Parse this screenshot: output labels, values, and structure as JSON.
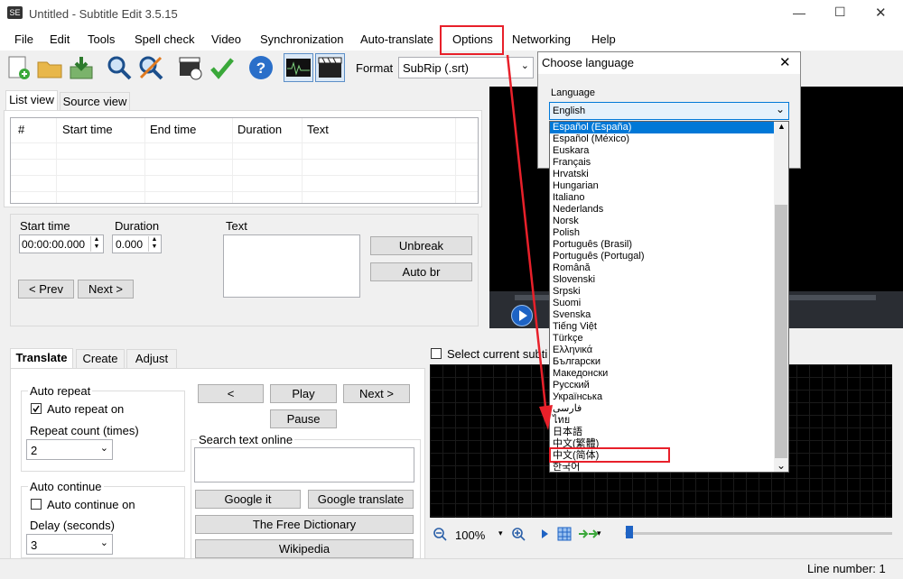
{
  "window": {
    "title": "Untitled - Subtitle Edit 3.5.15",
    "app_icon_text": "SE",
    "minimize": "—",
    "maximize": "☐",
    "close": "✕"
  },
  "menu": [
    "File",
    "Edit",
    "Tools",
    "Spell check",
    "Video",
    "Synchronization",
    "Auto-translate",
    "Options",
    "Networking",
    "Help"
  ],
  "toolbar": {
    "format_label": "Format",
    "format_value": "SubRip (.srt)"
  },
  "list": {
    "tabs": [
      "List view",
      "Source view"
    ],
    "columns": [
      "#",
      "Start time",
      "End time",
      "Duration",
      "Text"
    ]
  },
  "editor": {
    "start_time_label": "Start time",
    "start_time_value": "00:00:00.000",
    "duration_label": "Duration",
    "duration_value": "0.000",
    "text_label": "Text",
    "unbreak": "Unbreak",
    "auto_br": "Auto br",
    "prev": "< Prev",
    "next": "Next >"
  },
  "bottom_tabs": [
    "Translate",
    "Create",
    "Adjust"
  ],
  "translate": {
    "auto_repeat_group": "Auto repeat",
    "auto_repeat_on": "Auto repeat on",
    "repeat_count_label": "Repeat count (times)",
    "repeat_count_value": "2",
    "auto_continue_group": "Auto continue",
    "auto_continue_on": "Auto continue on",
    "delay_label": "Delay (seconds)",
    "delay_value": "3",
    "prev_btn": "<",
    "play_btn": "Play",
    "next_btn": "Next >",
    "pause_btn": "Pause",
    "search_group": "Search text online",
    "google_it": "Google it",
    "google_translate": "Google translate",
    "free_dictionary": "The Free Dictionary",
    "wikipedia": "Wikipedia"
  },
  "waveform": {
    "select_current": "Select current subti",
    "zoom": "100%"
  },
  "status": {
    "line_number": "Line number: 1"
  },
  "dialog": {
    "title": "Choose language",
    "language_label": "Language",
    "selected": "English",
    "options": [
      "Español (España)",
      "Español (México)",
      "Euskara",
      "Français",
      "Hrvatski",
      "Hungarian",
      "Italiano",
      "Nederlands",
      "Norsk",
      "Polish",
      "Português (Brasil)",
      "Português (Portugal)",
      "Română",
      "Slovenski",
      "Srpski",
      "Suomi",
      "Svenska",
      "Tiếng Việt",
      "Türkçe",
      "Ελληνικά",
      "Български",
      "Македонски",
      "Русский",
      "Українська",
      "فارسی",
      "ไทย",
      "日本語",
      "中文(繁體)",
      "中文(简体)",
      "한국어"
    ]
  },
  "colors": {
    "highlight": "#0078d7",
    "annotation": "#e8202a",
    "video_bg": "#000000"
  }
}
